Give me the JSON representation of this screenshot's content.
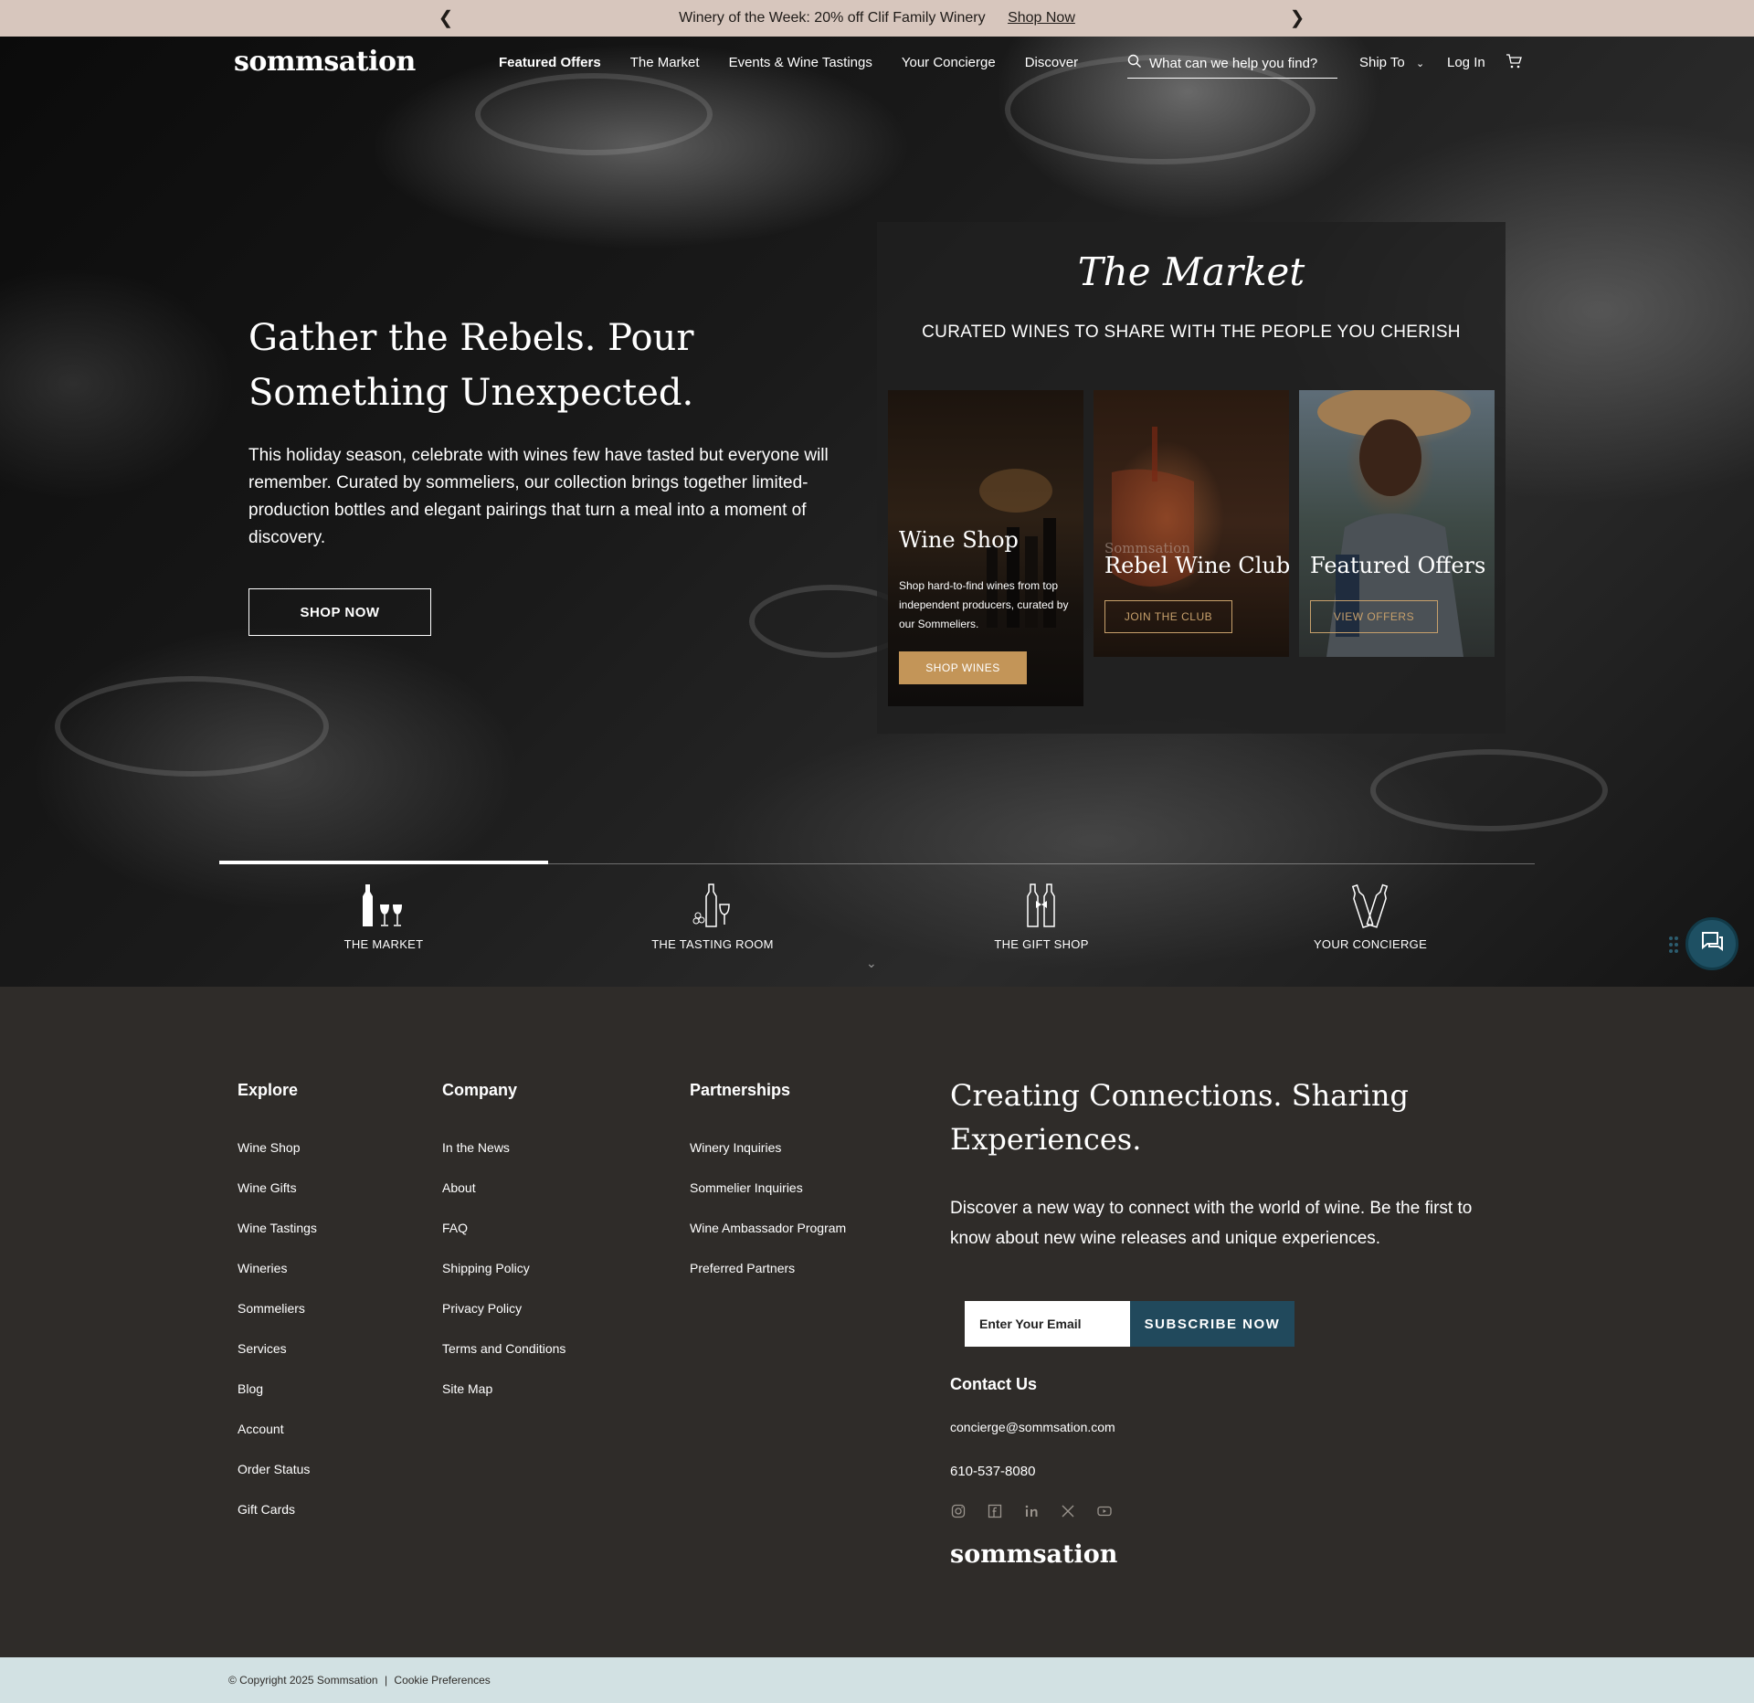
{
  "announcement": {
    "message": "Winery of the Week: 20% off Clif Family Winery",
    "link": "Shop Now"
  },
  "header": {
    "logo": "sommsation",
    "nav": [
      "Featured Offers",
      "The Market",
      "Events & Wine Tastings",
      "Your Concierge",
      "Discover"
    ],
    "search_placeholder": "What can we help you find?",
    "ship_to": "Ship To",
    "login": "Log In"
  },
  "hero": {
    "title": "Gather the Rebels. Pour Something Unexpected.",
    "description": "This holiday season, celebrate with wines few have tasted but everyone will remember. Curated by sommeliers, our collection brings together limited-production bottles and elegant pairings that turn a meal into a moment of discovery.",
    "button": "SHOP NOW"
  },
  "market": {
    "title": "The Market",
    "subtitle": "CURATED WINES TO SHARE WITH THE PEOPLE YOU CHERISH",
    "cards": [
      {
        "title": "Wine Shop",
        "body": "Shop hard-to-find wines from top independent producers, curated by our Sommeliers.",
        "button": "SHOP WINES"
      },
      {
        "title": "Rebel Wine Club",
        "button": "JOIN THE CLUB",
        "image_text": "Sommsation"
      },
      {
        "title": "Featured Offers",
        "button": "VIEW OFFERS"
      }
    ]
  },
  "tabs": [
    {
      "label": "THE MARKET",
      "icon": "wine-bottle-glasses-icon",
      "active": true
    },
    {
      "label": "THE TASTING ROOM",
      "icon": "bottle-grapes-glass-icon",
      "active": false
    },
    {
      "label": "THE GIFT SHOP",
      "icon": "gift-bottles-icon",
      "active": false
    },
    {
      "label": "YOUR CONCIERGE",
      "icon": "cheers-bottles-icon",
      "active": false
    }
  ],
  "footer": {
    "explore": {
      "heading": "Explore",
      "links": [
        "Wine Shop",
        "Wine Gifts",
        "Wine Tastings",
        "Wineries",
        "Sommeliers",
        "Services",
        "Blog",
        "Account",
        "Order Status",
        "Gift Cards"
      ]
    },
    "company": {
      "heading": "Company",
      "links": [
        "In the News",
        "About",
        "FAQ",
        "Shipping Policy",
        "Privacy Policy",
        "Terms and Conditions",
        "Site Map"
      ]
    },
    "partnerships": {
      "heading": "Partnerships",
      "links": [
        "Winery Inquiries",
        "Sommelier Inquiries",
        "Wine Ambassador Program",
        "Preferred Partners"
      ]
    },
    "cta_title": "Creating Connections. Sharing Experiences.",
    "cta_desc": "Discover a new way to connect with the world of wine. Be the first to know about new wine releases and unique experiences.",
    "email_placeholder": "Enter Your Email",
    "subscribe": "SUBSCRIBE NOW",
    "contact_heading": "Contact Us",
    "email": "concierge@sommsation.com",
    "phone": "610-537-8080",
    "socials": [
      "instagram-icon",
      "facebook-icon",
      "linkedin-icon",
      "x-icon",
      "youtube-icon"
    ],
    "logo": "sommsation"
  },
  "copyright": {
    "text": "© Copyright 2025 Sommsation",
    "separator": "|",
    "cookie": "Cookie Preferences"
  },
  "colors": {
    "announcement_bg": "#d7c6bd",
    "footer_bg": "#2f2c29",
    "gold_accent": "#c39558",
    "subscribe_bg": "#21495c",
    "chat_bg": "#1e5063",
    "copyright_bg": "#d2e1e3"
  }
}
